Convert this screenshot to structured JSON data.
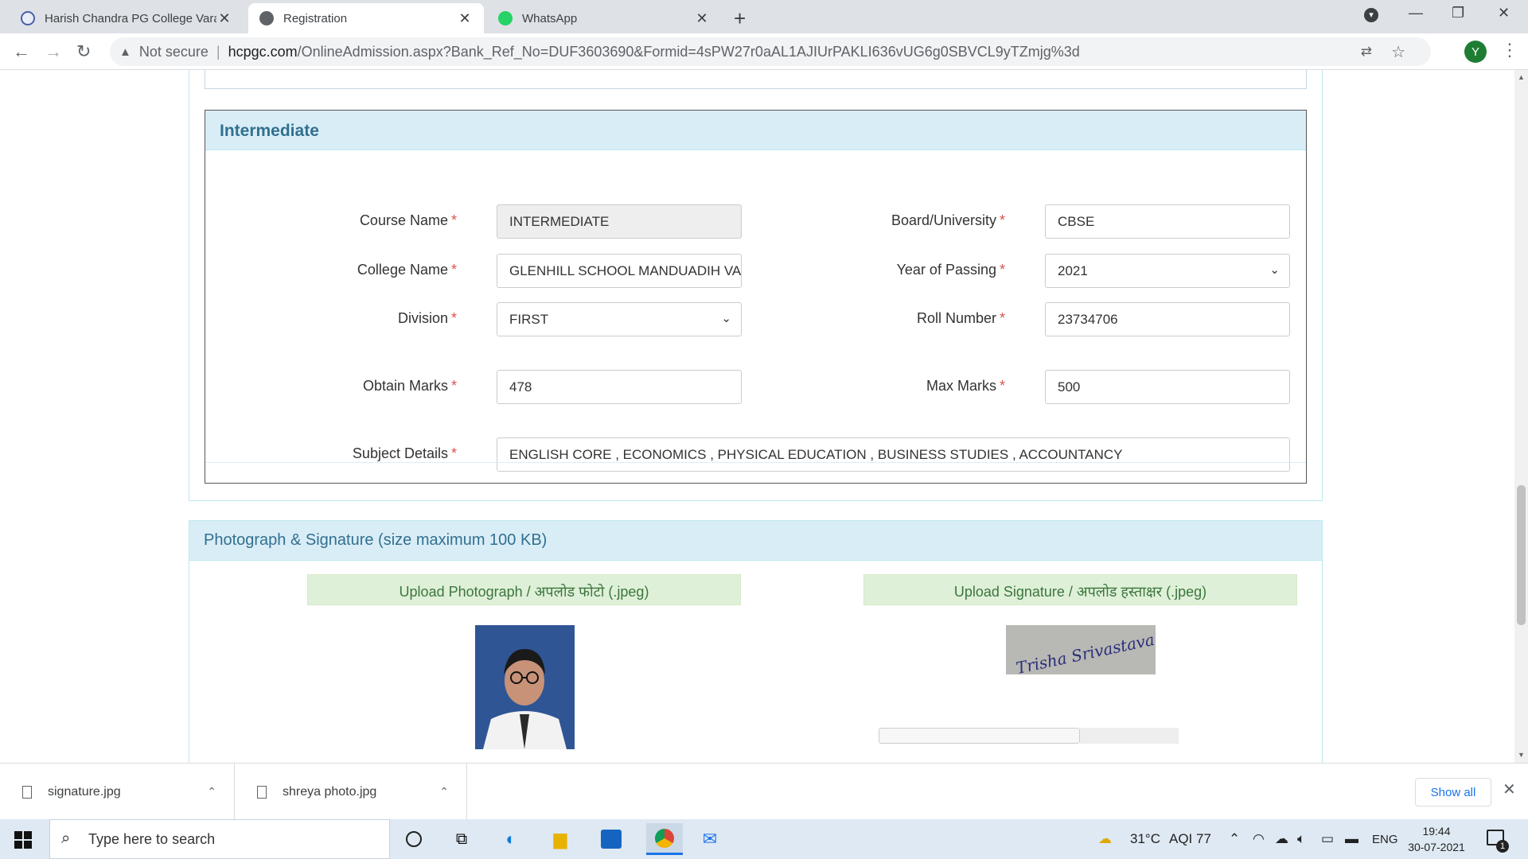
{
  "browser": {
    "tabs": [
      {
        "title": "Harish Chandra PG College Varan",
        "active": false,
        "favicon": "college-icon"
      },
      {
        "title": "Registration",
        "active": true,
        "favicon": "globe-icon"
      },
      {
        "title": "WhatsApp",
        "active": false,
        "favicon": "whatsapp-icon"
      }
    ],
    "security_label": "Not secure",
    "url_host": "hcpgc.com",
    "url_path": "/OnlineAdmission.aspx?Bank_Ref_No=DUF3603690&Formid=4sPW27r0aAL1AJIUrPAKLI636vUG6g0SBVCL9yTZmjg%3d",
    "profile_initial": "Y"
  },
  "intermediate": {
    "heading": "Intermediate",
    "fields": {
      "course_name": {
        "label": "Course Name",
        "value": "INTERMEDIATE"
      },
      "board": {
        "label": "Board/University",
        "value": "CBSE"
      },
      "college": {
        "label": "College Name",
        "value": "GLENHILL SCHOOL MANDUADIH VARANASI"
      },
      "year": {
        "label": "Year of Passing",
        "value": "2021"
      },
      "division": {
        "label": "Division",
        "value": "FIRST"
      },
      "roll": {
        "label": "Roll Number",
        "value": "23734706"
      },
      "obtain": {
        "label": "Obtain Marks",
        "value": "478"
      },
      "max": {
        "label": "Max Marks",
        "value": "500"
      },
      "subjects": {
        "label": "Subject Details",
        "value": "ENGLISH CORE , ECONOMICS , PHYSICAL EDUCATION , BUSINESS STUDIES , ACCOUNTANCY"
      }
    },
    "required_mark": "*"
  },
  "photo_section": {
    "heading": "Photograph & Signature (size maximum 100 KB)",
    "upload_photo_label": "Upload Photograph / अपलोड फोटो (.jpeg)",
    "upload_signature_label": "Upload Signature / अपलोड हस्ताक्षर (.jpeg)",
    "signature_text": "Trisha Srivastava"
  },
  "downloads": {
    "items": [
      "signature.jpg",
      "shreya photo.jpg"
    ],
    "show_all": "Show all"
  },
  "taskbar": {
    "search_placeholder": "Type here to search",
    "weather": "31°C",
    "aqi": "AQI 77",
    "language": "ENG",
    "time": "19:44",
    "date": "30-07-2021",
    "notification_count": "1"
  }
}
